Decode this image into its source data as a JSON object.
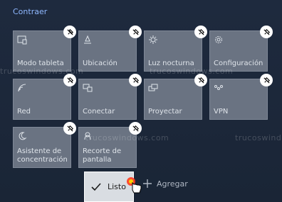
{
  "header": {
    "collapse_label": "Contraer"
  },
  "tiles": [
    {
      "name": "modo-tableta",
      "label": "Modo tableta",
      "icon": "tablet-icon"
    },
    {
      "name": "ubicacion",
      "label": "Ubicación",
      "icon": "location-icon"
    },
    {
      "name": "luz-nocturna",
      "label": "Luz nocturna",
      "icon": "night-light-icon"
    },
    {
      "name": "configuracion",
      "label": "Configuración",
      "icon": "gear-icon"
    },
    {
      "name": "red",
      "label": "Red",
      "icon": "network-icon"
    },
    {
      "name": "conectar",
      "label": "Conectar",
      "icon": "connect-icon"
    },
    {
      "name": "proyectar",
      "label": "Proyectar",
      "icon": "project-icon"
    },
    {
      "name": "vpn",
      "label": "VPN",
      "icon": "vpn-icon"
    },
    {
      "name": "asistente",
      "label": "Asistente de\nconcentración",
      "icon": "moon-icon"
    },
    {
      "name": "recorte",
      "label": "Recorte de\npantalla",
      "icon": "snip-icon"
    }
  ],
  "footer": {
    "done_label": "Listo",
    "add_label": "Agregar"
  },
  "watermark": "trucoswindows.com",
  "colors": {
    "accent": "#8fb8ff",
    "tile": "#6a7382",
    "background": "#1f2a3d"
  }
}
